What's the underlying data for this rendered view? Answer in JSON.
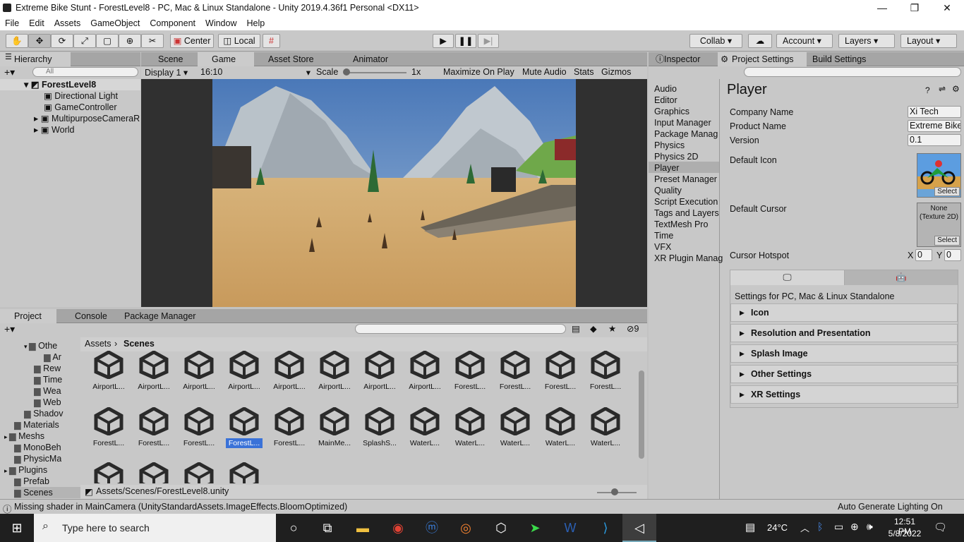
{
  "titlebar": {
    "title": "Extreme Bike Stunt - ForestLevel8 - PC, Mac & Linux Standalone - Unity 2019.4.36f1 Personal <DX11>",
    "minimize": "—",
    "maximize": "❐",
    "close": "✕"
  },
  "menu": [
    "File",
    "Edit",
    "Assets",
    "GameObject",
    "Component",
    "Window",
    "Help"
  ],
  "toolbar": {
    "center": "Center",
    "local": "Local",
    "collab": "Collab ▾",
    "account": "Account",
    "layers": "Layers",
    "layout": "Layout"
  },
  "hierarchy": {
    "tab": "Hierarchy",
    "search_placeholder": "All",
    "scene": "ForestLevel8",
    "items": [
      "Directional Light",
      "GameController",
      "MultipurposeCameraR",
      "World"
    ]
  },
  "game": {
    "tabs": [
      "Scene",
      "Game",
      "Asset Store",
      "Animator"
    ],
    "display": "Display 1",
    "aspect": "16:10",
    "scale_label": "Scale",
    "scale_value": "1x",
    "maximize": "Maximize On Play",
    "mute": "Mute Audio",
    "stats": "Stats",
    "gizmos": "Gizmos"
  },
  "inspector": {
    "tabs": [
      "Inspector",
      "Project Settings",
      "Build Settings"
    ]
  },
  "settings": {
    "categories": [
      "Audio",
      "Editor",
      "Graphics",
      "Input Manager",
      "Package Manag",
      "Physics",
      "Physics 2D",
      "Player",
      "Preset Manager",
      "Quality",
      "Script Execution",
      "Tags and Layers",
      "TextMesh Pro",
      "Time",
      "VFX",
      "XR Plugin Manag"
    ],
    "selected_index": 7,
    "title": "Player",
    "company_label": "Company Name",
    "company": "Xi Tech",
    "product_label": "Product Name",
    "product": "Extreme Bike",
    "version_label": "Version",
    "version": "0.1",
    "default_icon_label": "Default Icon",
    "select": "Select",
    "default_cursor_label": "Default Cursor",
    "cursor_none": "None (Texture 2D)",
    "hotspot_label": "Cursor Hotspot",
    "hx_label": "X",
    "hx": "0",
    "hy_label": "Y",
    "hy": "0",
    "platform_heading": "Settings for PC, Mac & Linux Standalone",
    "sections": [
      "Icon",
      "Resolution and Presentation",
      "Splash Image",
      "Other Settings",
      "XR Settings"
    ]
  },
  "project": {
    "tabs": [
      "Project",
      "Console",
      "Package Manager"
    ],
    "count": "9",
    "breadcrumb": [
      "Assets",
      "Scenes"
    ],
    "folders": [
      "Othe",
      "Ar",
      "Rew",
      "Time",
      "Wea",
      "Web",
      "Shadov",
      "Materials",
      "Meshs",
      "MonoBeh",
      "PhysicMa",
      "Plugins",
      "Prefab",
      "Scenes"
    ],
    "assets_row1": [
      "AirportL...",
      "AirportL...",
      "AirportL...",
      "AirportL...",
      "AirportL...",
      "AirportL...",
      "AirportL...",
      "AirportL...",
      "ForestL...",
      "ForestL...",
      "ForestL...",
      "ForestL..."
    ],
    "assets_row2": [
      "ForestL...",
      "ForestL...",
      "ForestL...",
      "ForestL...",
      "ForestL...",
      "MainMe...",
      "SplashS...",
      "WaterL...",
      "WaterL...",
      "WaterL...",
      "WaterL...",
      "WaterL..."
    ],
    "selected_row2_index": 3,
    "path": "Assets/Scenes/ForestLevel8.unity"
  },
  "status": {
    "message": "Missing shader in MainCamera (UnityStandardAssets.ImageEffects.BloomOptimized)",
    "right": "Auto Generate Lighting On"
  },
  "taskbar": {
    "search": "Type here to search",
    "temp": "24°C",
    "time": "12:51 PM",
    "date": "5/8/2022"
  }
}
